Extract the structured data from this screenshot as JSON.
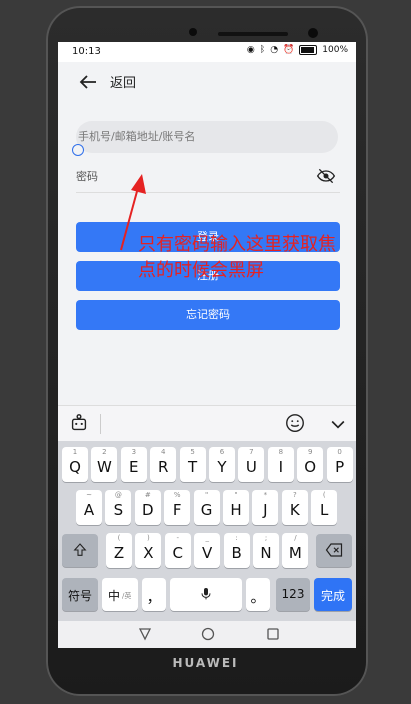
{
  "status_bar": {
    "time": "10:13",
    "battery": "100%"
  },
  "header": {
    "back_label": "返回"
  },
  "form": {
    "account_placeholder": "手机号/邮箱地址/账号名",
    "password_placeholder": "密码"
  },
  "buttons": {
    "login": "登录",
    "register": "注册",
    "forgot": "忘记密码"
  },
  "annotation": "只有密码输入这里获取焦点的时候会黑屏",
  "keyboard": {
    "row1": [
      {
        "main": "Q",
        "sub": "1"
      },
      {
        "main": "W",
        "sub": "2"
      },
      {
        "main": "E",
        "sub": "3"
      },
      {
        "main": "R",
        "sub": "4"
      },
      {
        "main": "T",
        "sub": "5"
      },
      {
        "main": "Y",
        "sub": "6"
      },
      {
        "main": "U",
        "sub": "7"
      },
      {
        "main": "I",
        "sub": "8"
      },
      {
        "main": "O",
        "sub": "9"
      },
      {
        "main": "P",
        "sub": "0"
      }
    ],
    "row2": [
      {
        "main": "A",
        "sub": "~"
      },
      {
        "main": "S",
        "sub": "@"
      },
      {
        "main": "D",
        "sub": "#"
      },
      {
        "main": "F",
        "sub": "%"
      },
      {
        "main": "G",
        "sub": "\""
      },
      {
        "main": "H",
        "sub": "\""
      },
      {
        "main": "J",
        "sub": "*"
      },
      {
        "main": "K",
        "sub": "?"
      },
      {
        "main": "L",
        "sub": "("
      }
    ],
    "row3": [
      {
        "main": "Z",
        "sub": "("
      },
      {
        "main": "X",
        "sub": ")"
      },
      {
        "main": "C",
        "sub": "-"
      },
      {
        "main": "V",
        "sub": "_"
      },
      {
        "main": "B",
        "sub": ":"
      },
      {
        "main": "N",
        "sub": ";"
      },
      {
        "main": "M",
        "sub": "/"
      }
    ],
    "symbols": "符号",
    "lang": "中",
    "lang_sub": "/英",
    "comma": "，",
    "period": "。",
    "numbers": "123",
    "done": "完成"
  },
  "brand": "HUAWEI"
}
